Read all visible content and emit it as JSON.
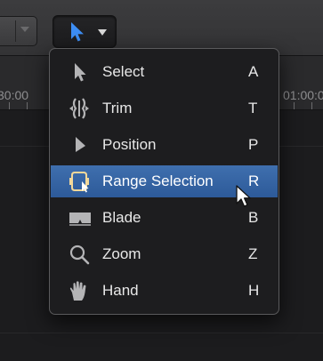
{
  "toolbar": {
    "tool_button": {
      "icon": "select-arrow-icon",
      "dropdown_icon": "chevron-down-icon",
      "color": "#3d8ef5"
    }
  },
  "ruler": {
    "left_label": "30:00",
    "right_label": "01:00:0"
  },
  "menu": {
    "items": [
      {
        "label": "Select",
        "shortcut": "A",
        "icon": "select-arrow-icon",
        "highlighted": false
      },
      {
        "label": "Trim",
        "shortcut": "T",
        "icon": "trim-icon",
        "highlighted": false
      },
      {
        "label": "Position",
        "shortcut": "P",
        "icon": "position-icon",
        "highlighted": false
      },
      {
        "label": "Range Selection",
        "shortcut": "R",
        "icon": "range-selection-icon",
        "highlighted": true
      },
      {
        "label": "Blade",
        "shortcut": "B",
        "icon": "blade-icon",
        "highlighted": false
      },
      {
        "label": "Zoom",
        "shortcut": "Z",
        "icon": "zoom-icon",
        "highlighted": false
      },
      {
        "label": "Hand",
        "shortcut": "H",
        "icon": "hand-icon",
        "highlighted": false
      }
    ]
  },
  "colors": {
    "highlight": "#3466a8",
    "accent": "#3d8ef5",
    "menu_background": "#1d1d1f",
    "text": "#e8e8e8"
  }
}
